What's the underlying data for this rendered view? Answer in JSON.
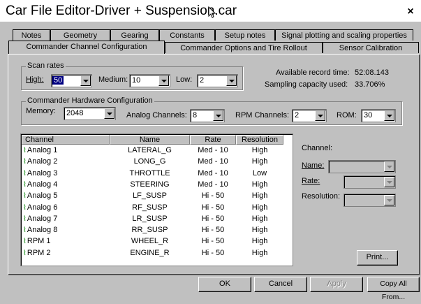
{
  "window": {
    "title": "Car File Editor-Driver + Suspension.car",
    "close_label": "×"
  },
  "tabs": {
    "row1": [
      "Notes",
      "Geometry",
      "Gearing",
      "Constants",
      "Setup notes",
      "Signal plotting and scaling properties"
    ],
    "row2": [
      "Commander Channel Configuration",
      "Commander Options and Tire Rollout",
      "Sensor Calibration"
    ],
    "active": "Commander Channel Configuration"
  },
  "scan_rates": {
    "title": "Scan rates",
    "high_label": "High:",
    "high_value": "50",
    "medium_label": "Medium:",
    "medium_value": "10",
    "low_label": "Low:",
    "low_value": "2"
  },
  "record_info": {
    "available_label": "Available record time:",
    "available_value": "52:08.143",
    "sampling_label": "Sampling capacity used:",
    "sampling_value": "33.706%"
  },
  "hardware": {
    "title": "Commander Hardware Configuration",
    "memory_label": "Memory:",
    "memory_value": "2048",
    "analog_label": "Analog Channels:",
    "analog_value": "8",
    "rpm_label": "RPM Channels:",
    "rpm_value": "2",
    "rom_label": "ROM:",
    "rom_value": "30"
  },
  "table": {
    "headers": [
      "Channel",
      "Name",
      "Rate",
      "Resolution"
    ],
    "rows": [
      {
        "channel": "Analog 1",
        "name": "LATERAL_G",
        "rate": "Med - 10",
        "resolution": "High"
      },
      {
        "channel": "Analog 2",
        "name": "LONG_G",
        "rate": "Med - 10",
        "resolution": "High"
      },
      {
        "channel": "Analog 3",
        "name": "THROTTLE",
        "rate": "Med - 10",
        "resolution": "Low"
      },
      {
        "channel": "Analog 4",
        "name": "STEERING",
        "rate": "Med - 10",
        "resolution": "High"
      },
      {
        "channel": "Analog 5",
        "name": "LF_SUSP",
        "rate": "Hi - 50",
        "resolution": "High"
      },
      {
        "channel": "Analog 6",
        "name": "RF_SUSP",
        "rate": "Hi - 50",
        "resolution": "High"
      },
      {
        "channel": "Analog 7",
        "name": "LR_SUSP",
        "rate": "Hi - 50",
        "resolution": "High"
      },
      {
        "channel": "Analog 8",
        "name": "RR_SUSP",
        "rate": "Hi - 50",
        "resolution": "High"
      },
      {
        "channel": "RPM 1",
        "name": "WHEEL_R",
        "rate": "Hi - 50",
        "resolution": "High"
      },
      {
        "channel": "RPM 2",
        "name": "ENGINE_R",
        "rate": "Hi - 50",
        "resolution": "High"
      }
    ]
  },
  "detail": {
    "channel_label": "Channel:",
    "name_label": "Name:",
    "rate_label": "Rate:",
    "resolution_label": "Resolution:",
    "print_label": "Print..."
  },
  "footer": {
    "ok_label": "OK",
    "cancel_label": "Cancel",
    "apply_label": "Apply",
    "copy_all_label": "Copy All From..."
  },
  "icons": {
    "signal": "signal-wave-icon",
    "cursor": "mouse-pointer-icon"
  },
  "colors": {
    "face": "#c0c0c0",
    "selection": "#000080",
    "signal_icon": "#008000"
  }
}
